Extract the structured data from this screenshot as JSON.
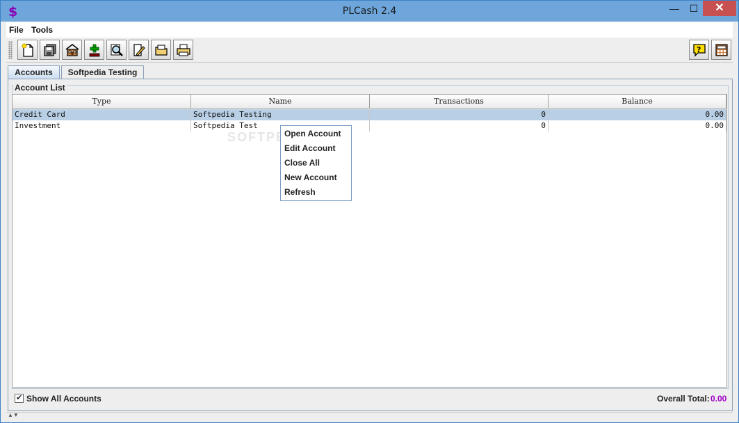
{
  "window": {
    "title": "PLCash 2.4",
    "minimize": "—",
    "maximize": "☐",
    "close": "✕"
  },
  "menu": {
    "items": [
      "File",
      "Tools"
    ]
  },
  "toolbar": {
    "left_buttons": [
      "new-icon",
      "save-icon",
      "home-icon",
      "add-icon",
      "search-icon",
      "edit-icon",
      "folder-icon",
      "print-icon"
    ],
    "right_buttons": [
      "help-icon",
      "calculator-icon"
    ]
  },
  "tabs": [
    {
      "label": "Accounts",
      "active": true
    },
    {
      "label": "Softpedia Testing",
      "active": false
    }
  ],
  "account_list": {
    "legend": "Account List",
    "columns": [
      "Type",
      "Name",
      "Transactions",
      "Balance"
    ],
    "rows": [
      {
        "type": "Credit Card",
        "name": "Softpedia Testing",
        "transactions": "0",
        "balance": "0.00",
        "selected": true
      },
      {
        "type": "Investment",
        "name": "Softpedia Test",
        "transactions": "0",
        "balance": "0.00",
        "selected": false
      }
    ]
  },
  "context_menu": {
    "items": [
      "Open Account",
      "Edit Account",
      "Close All",
      "New Account",
      "Refresh"
    ]
  },
  "watermark": "SOFTPEDIA",
  "footer": {
    "show_all_label": "Show All Accounts",
    "show_all_checked": true,
    "check_mark": "✔",
    "total_label": "Overall Total:",
    "total_value": "0.00"
  },
  "colors": {
    "total_value": "#a000c8",
    "accent": "#6ea6dc",
    "selection": "#b8cfe5"
  }
}
